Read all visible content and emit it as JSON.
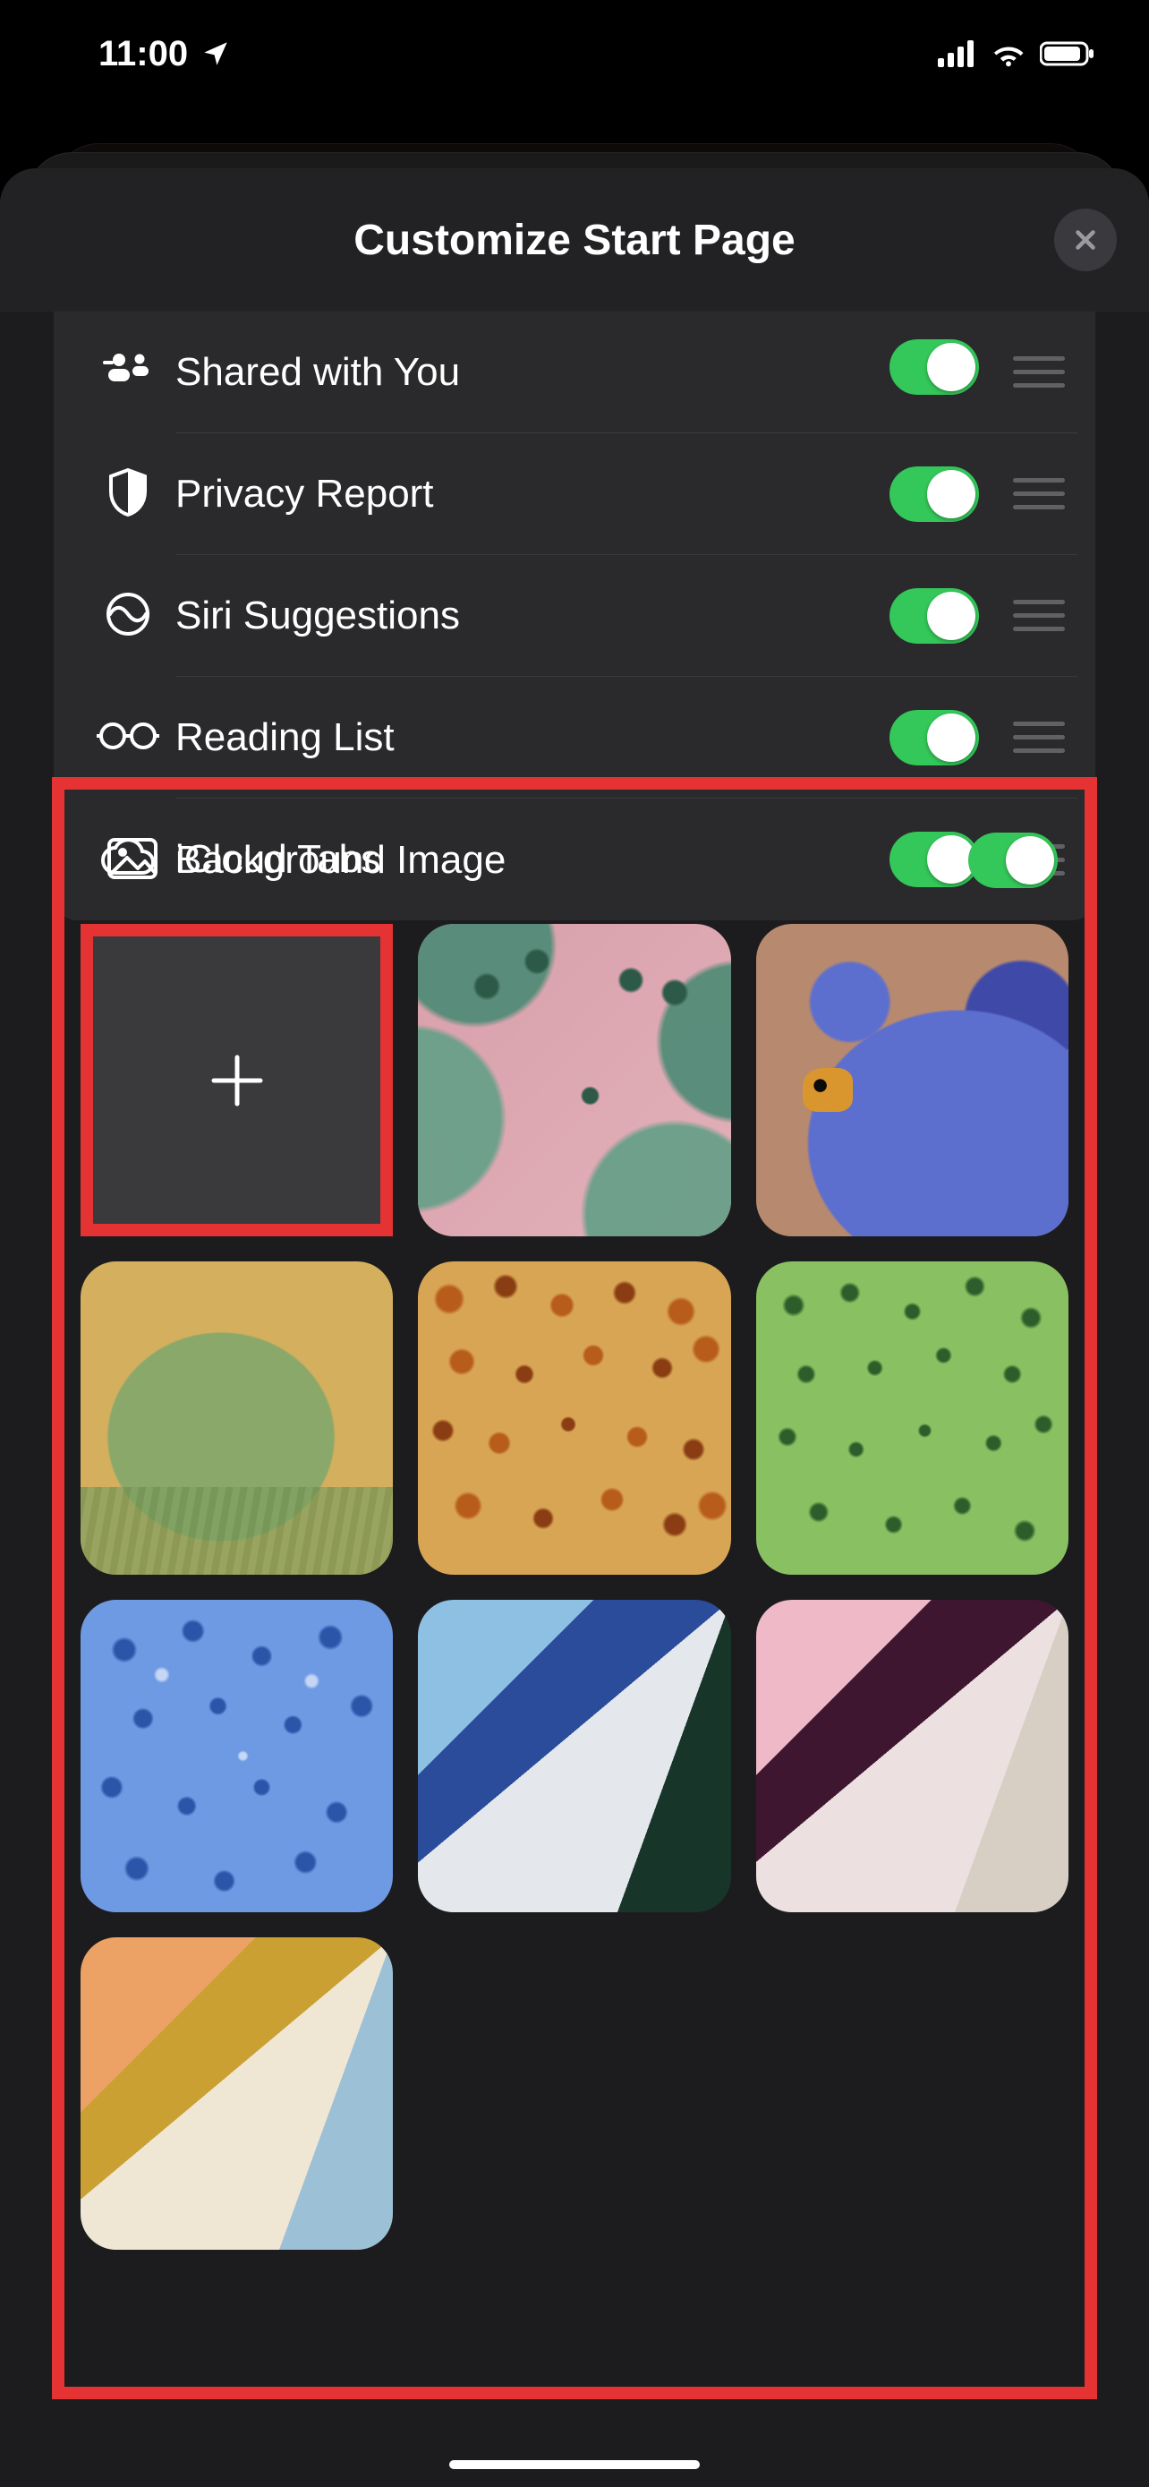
{
  "status": {
    "time": "11:00"
  },
  "sheet": {
    "title": "Customize Start Page"
  },
  "rows": [
    {
      "label": "Shared with You",
      "icon": "people-icon",
      "on": true
    },
    {
      "label": "Privacy Report",
      "icon": "shield-icon",
      "on": true
    },
    {
      "label": "Siri Suggestions",
      "icon": "siri-icon",
      "on": true
    },
    {
      "label": "Reading List",
      "icon": "glasses-icon",
      "on": true
    },
    {
      "label": "iCloud Tabs",
      "icon": "cloud-icon",
      "on": true
    }
  ],
  "background_section": {
    "label": "Background Image",
    "on": true,
    "tiles": [
      {
        "kind": "add"
      },
      {
        "kind": "butterfly"
      },
      {
        "kind": "bear"
      },
      {
        "kind": "parrot"
      },
      {
        "kind": "confetti"
      },
      {
        "kind": "green"
      },
      {
        "kind": "bluedots"
      },
      {
        "kind": "tri-blue"
      },
      {
        "kind": "tri-pink"
      },
      {
        "kind": "tri-orange"
      }
    ]
  }
}
